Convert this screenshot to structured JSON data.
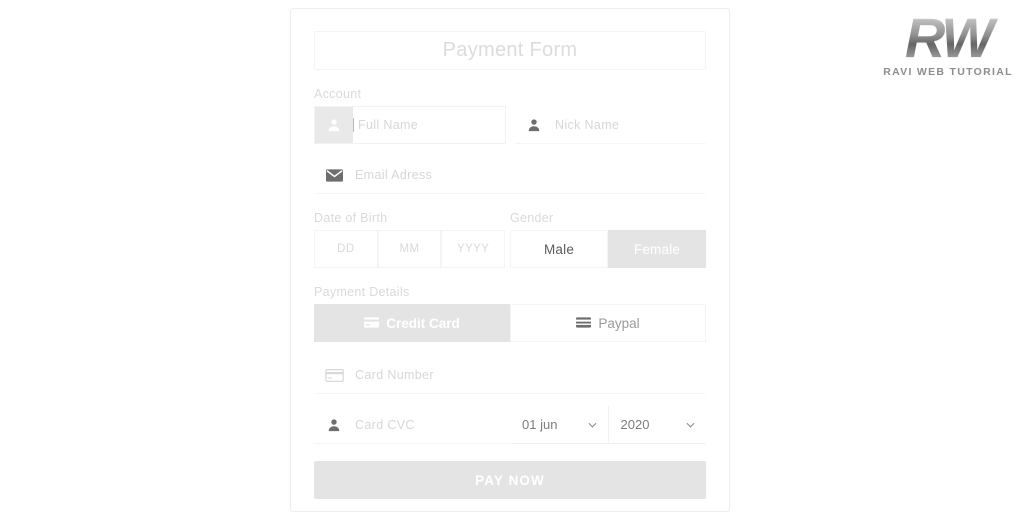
{
  "form": {
    "title": "Payment Form",
    "sections": {
      "account_label": "Account",
      "dob_label": "Date of Birth",
      "gender_label": "Gender",
      "payment_label": "Payment Details"
    },
    "fields": {
      "full_name_placeholder": "Full Name",
      "nick_name_placeholder": "Nick Name",
      "email_placeholder": "Email Adress",
      "dob_day_placeholder": "DD",
      "dob_month_placeholder": "MM",
      "dob_year_placeholder": "YYYY",
      "card_number_placeholder": "Card Number",
      "card_cvc_placeholder": "Card CVC"
    },
    "gender": {
      "male_label": "Male",
      "female_label": "Female",
      "selected": "Female"
    },
    "payment_methods": {
      "credit_card_label": "Credit Card",
      "paypal_label": "Paypal",
      "selected": "Credit Card"
    },
    "selects": {
      "month_value": "01 jun",
      "year_value": "2020",
      "chevron": "⌄"
    },
    "submit_label": "PAY NOW"
  },
  "watermark": {
    "logo_text": "RW",
    "caption": "RAVI WEB TUTORIAL"
  },
  "colors": {
    "selected_bg": "#e4e4e4",
    "placeholder": "#d7d7d7",
    "label": "#dadada",
    "icon_dark": "#6e6e6e",
    "card_border": "#efefef"
  }
}
